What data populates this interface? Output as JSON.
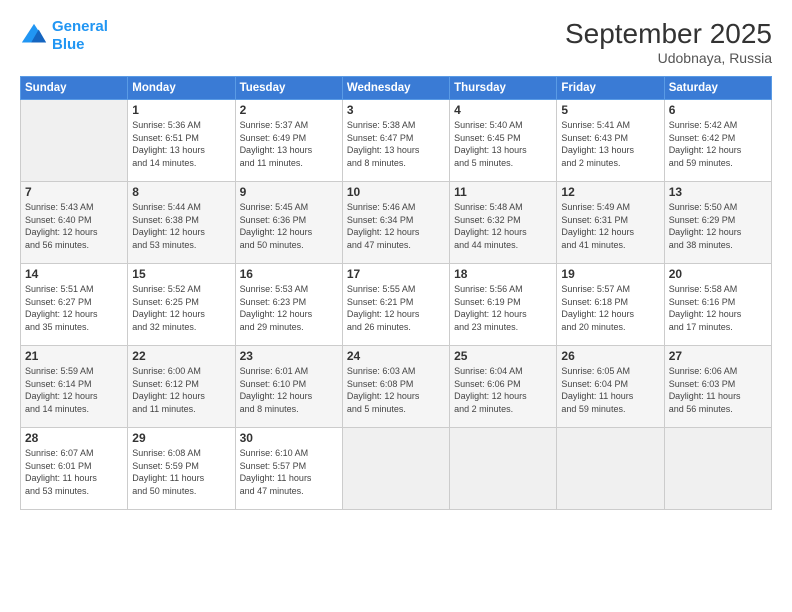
{
  "header": {
    "logo_line1": "General",
    "logo_line2": "Blue",
    "month": "September 2025",
    "location": "Udobnaya, Russia"
  },
  "weekdays": [
    "Sunday",
    "Monday",
    "Tuesday",
    "Wednesday",
    "Thursday",
    "Friday",
    "Saturday"
  ],
  "weeks": [
    [
      {
        "day": "",
        "info": ""
      },
      {
        "day": "1",
        "info": "Sunrise: 5:36 AM\nSunset: 6:51 PM\nDaylight: 13 hours\nand 14 minutes."
      },
      {
        "day": "2",
        "info": "Sunrise: 5:37 AM\nSunset: 6:49 PM\nDaylight: 13 hours\nand 11 minutes."
      },
      {
        "day": "3",
        "info": "Sunrise: 5:38 AM\nSunset: 6:47 PM\nDaylight: 13 hours\nand 8 minutes."
      },
      {
        "day": "4",
        "info": "Sunrise: 5:40 AM\nSunset: 6:45 PM\nDaylight: 13 hours\nand 5 minutes."
      },
      {
        "day": "5",
        "info": "Sunrise: 5:41 AM\nSunset: 6:43 PM\nDaylight: 13 hours\nand 2 minutes."
      },
      {
        "day": "6",
        "info": "Sunrise: 5:42 AM\nSunset: 6:42 PM\nDaylight: 12 hours\nand 59 minutes."
      }
    ],
    [
      {
        "day": "7",
        "info": "Sunrise: 5:43 AM\nSunset: 6:40 PM\nDaylight: 12 hours\nand 56 minutes."
      },
      {
        "day": "8",
        "info": "Sunrise: 5:44 AM\nSunset: 6:38 PM\nDaylight: 12 hours\nand 53 minutes."
      },
      {
        "day": "9",
        "info": "Sunrise: 5:45 AM\nSunset: 6:36 PM\nDaylight: 12 hours\nand 50 minutes."
      },
      {
        "day": "10",
        "info": "Sunrise: 5:46 AM\nSunset: 6:34 PM\nDaylight: 12 hours\nand 47 minutes."
      },
      {
        "day": "11",
        "info": "Sunrise: 5:48 AM\nSunset: 6:32 PM\nDaylight: 12 hours\nand 44 minutes."
      },
      {
        "day": "12",
        "info": "Sunrise: 5:49 AM\nSunset: 6:31 PM\nDaylight: 12 hours\nand 41 minutes."
      },
      {
        "day": "13",
        "info": "Sunrise: 5:50 AM\nSunset: 6:29 PM\nDaylight: 12 hours\nand 38 minutes."
      }
    ],
    [
      {
        "day": "14",
        "info": "Sunrise: 5:51 AM\nSunset: 6:27 PM\nDaylight: 12 hours\nand 35 minutes."
      },
      {
        "day": "15",
        "info": "Sunrise: 5:52 AM\nSunset: 6:25 PM\nDaylight: 12 hours\nand 32 minutes."
      },
      {
        "day": "16",
        "info": "Sunrise: 5:53 AM\nSunset: 6:23 PM\nDaylight: 12 hours\nand 29 minutes."
      },
      {
        "day": "17",
        "info": "Sunrise: 5:55 AM\nSunset: 6:21 PM\nDaylight: 12 hours\nand 26 minutes."
      },
      {
        "day": "18",
        "info": "Sunrise: 5:56 AM\nSunset: 6:19 PM\nDaylight: 12 hours\nand 23 minutes."
      },
      {
        "day": "19",
        "info": "Sunrise: 5:57 AM\nSunset: 6:18 PM\nDaylight: 12 hours\nand 20 minutes."
      },
      {
        "day": "20",
        "info": "Sunrise: 5:58 AM\nSunset: 6:16 PM\nDaylight: 12 hours\nand 17 minutes."
      }
    ],
    [
      {
        "day": "21",
        "info": "Sunrise: 5:59 AM\nSunset: 6:14 PM\nDaylight: 12 hours\nand 14 minutes."
      },
      {
        "day": "22",
        "info": "Sunrise: 6:00 AM\nSunset: 6:12 PM\nDaylight: 12 hours\nand 11 minutes."
      },
      {
        "day": "23",
        "info": "Sunrise: 6:01 AM\nSunset: 6:10 PM\nDaylight: 12 hours\nand 8 minutes."
      },
      {
        "day": "24",
        "info": "Sunrise: 6:03 AM\nSunset: 6:08 PM\nDaylight: 12 hours\nand 5 minutes."
      },
      {
        "day": "25",
        "info": "Sunrise: 6:04 AM\nSunset: 6:06 PM\nDaylight: 12 hours\nand 2 minutes."
      },
      {
        "day": "26",
        "info": "Sunrise: 6:05 AM\nSunset: 6:04 PM\nDaylight: 11 hours\nand 59 minutes."
      },
      {
        "day": "27",
        "info": "Sunrise: 6:06 AM\nSunset: 6:03 PM\nDaylight: 11 hours\nand 56 minutes."
      }
    ],
    [
      {
        "day": "28",
        "info": "Sunrise: 6:07 AM\nSunset: 6:01 PM\nDaylight: 11 hours\nand 53 minutes."
      },
      {
        "day": "29",
        "info": "Sunrise: 6:08 AM\nSunset: 5:59 PM\nDaylight: 11 hours\nand 50 minutes."
      },
      {
        "day": "30",
        "info": "Sunrise: 6:10 AM\nSunset: 5:57 PM\nDaylight: 11 hours\nand 47 minutes."
      },
      {
        "day": "",
        "info": ""
      },
      {
        "day": "",
        "info": ""
      },
      {
        "day": "",
        "info": ""
      },
      {
        "day": "",
        "info": ""
      }
    ]
  ]
}
